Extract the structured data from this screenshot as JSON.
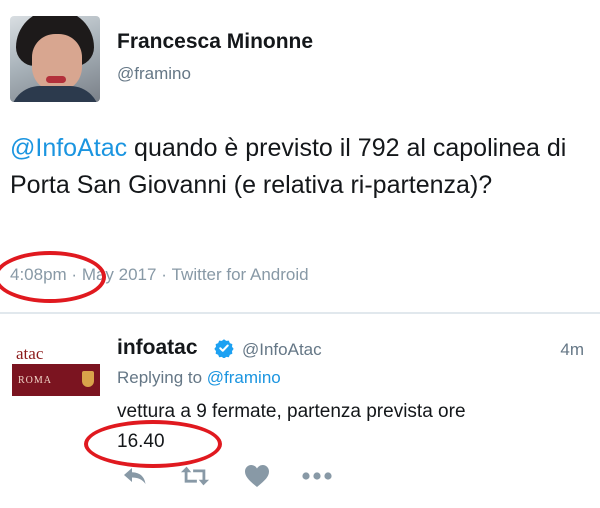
{
  "tweet": {
    "author_name": "Francesca Minonne",
    "author_handle": "@framino",
    "mention": "@InfoAtac",
    "text": " quando è previsto il 792 al capolinea di Porta San Giovanni (e relativa ri-partenza)?",
    "time": "4:08pm",
    "separator": " · ",
    "date": "May 2017",
    "source": "Twitter for Android"
  },
  "reply": {
    "author_name": "infoatac",
    "author_handle": "@InfoAtac",
    "time": "4m",
    "replying_label": "Replying to ",
    "replying_to": "@framino",
    "text_line1": "vettura a 9 fermate, partenza prevista ore",
    "text_line2": "16.40",
    "avatar_logo": "atac",
    "avatar_band": "ROMA"
  },
  "icons": {
    "verified": "verified-badge-icon",
    "reply": "reply-icon",
    "retweet": "retweet-icon",
    "like": "heart-icon",
    "more": "more-dots-icon"
  },
  "colors": {
    "link": "#1b95e0",
    "secondary_text": "#657786",
    "annotation": "#e0191f",
    "atac_brand": "#7b1420"
  }
}
